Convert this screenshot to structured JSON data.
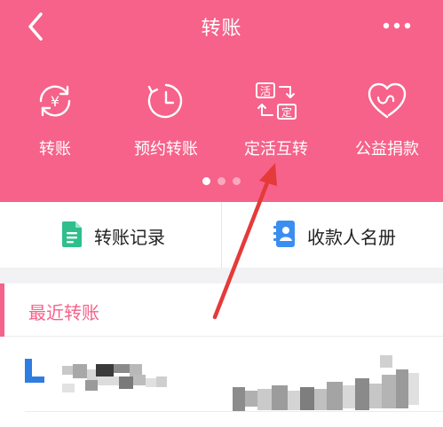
{
  "header": {
    "title": "转账",
    "background_color": "#f6628a"
  },
  "functions": [
    {
      "label": "转账",
      "icon": "transfer-yuan-icon"
    },
    {
      "label": "预约转账",
      "icon": "scheduled-clock-icon"
    },
    {
      "label": "定活互转",
      "icon": "fixed-current-swap-icon",
      "icon_text_top": "活",
      "icon_text_bottom": "定"
    },
    {
      "label": "公益捐款",
      "icon": "charity-heart-icon"
    }
  ],
  "pager": {
    "pages": 3,
    "active": 1
  },
  "shortcuts": [
    {
      "label": "转账记录",
      "icon": "document-icon",
      "color": "#2fbf8c"
    },
    {
      "label": "收款人名册",
      "icon": "address-book-icon",
      "color": "#3b8ef0"
    }
  ],
  "recent": {
    "label": "最近转账",
    "accent_color": "#f6628a"
  }
}
